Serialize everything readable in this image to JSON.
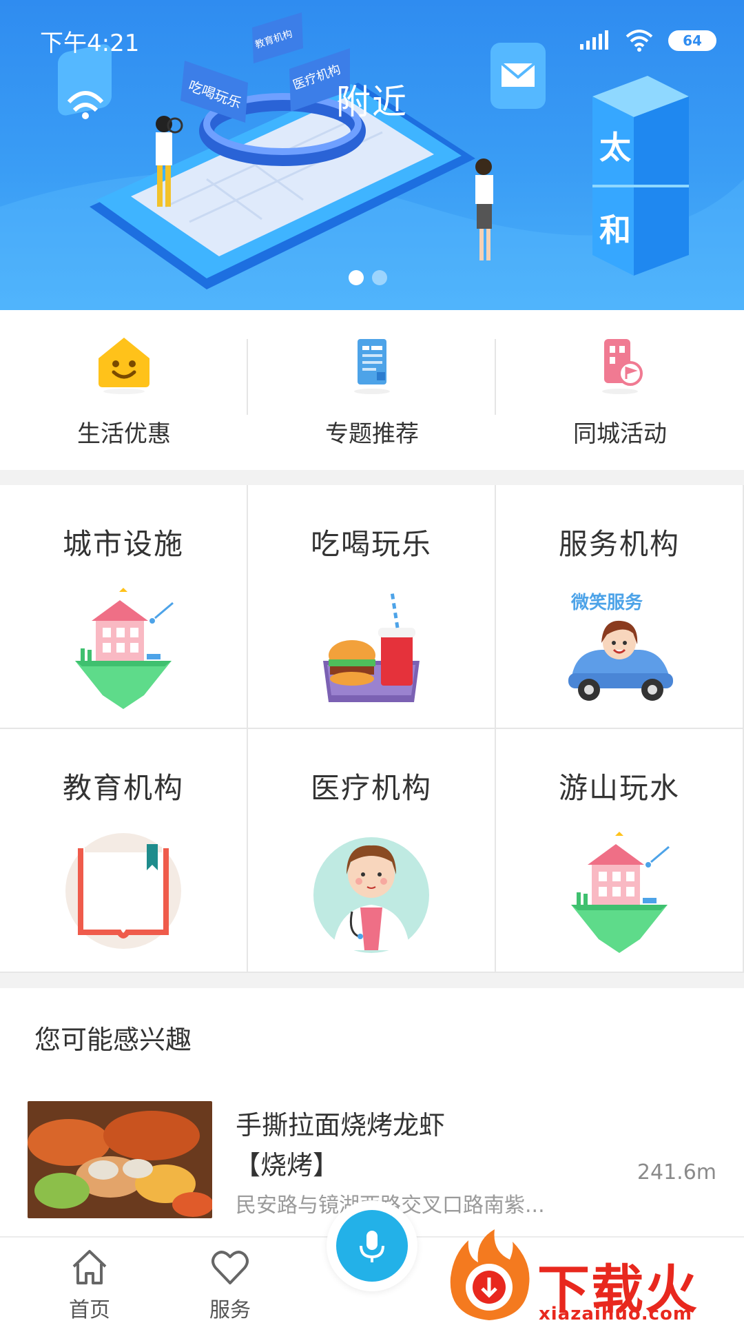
{
  "status_bar": {
    "time": "下午4:21",
    "battery": "64"
  },
  "banner": {
    "title": "附近",
    "tags": [
      "吃喝玩乐",
      "教育机构",
      "医疗机构"
    ],
    "side_text": [
      "太",
      "和"
    ],
    "slide_count": 2,
    "active_slide": 1
  },
  "quick_nav": [
    {
      "label": "生活优惠",
      "icon": "smiley-house-icon"
    },
    {
      "label": "专题推荐",
      "icon": "document-icon"
    },
    {
      "label": "同城活动",
      "icon": "building-flag-icon"
    }
  ],
  "categories": [
    {
      "title": "城市设施",
      "art": "floating-house-illustration"
    },
    {
      "title": "吃喝玩乐",
      "art": "burger-drink-tray-illustration"
    },
    {
      "title": "服务机构",
      "art": "smile-service-car-illustration",
      "art_text": "微笑服务"
    },
    {
      "title": "教育机构",
      "art": "open-book-illustration"
    },
    {
      "title": "医疗机构",
      "art": "doctor-illustration"
    },
    {
      "title": "游山玩水",
      "art": "floating-house-illustration"
    }
  ],
  "interest": {
    "title": "您可能感兴趣",
    "items": [
      {
        "name": "手撕拉面烧烤龙虾",
        "tag": "【烧烤】",
        "address": "民安路与镜湖西路交叉口路南紫...",
        "distance": "241.6m"
      }
    ]
  },
  "tabbar": {
    "tabs": [
      {
        "label": "首页",
        "icon": "home-icon"
      },
      {
        "label": "服务",
        "icon": "heart-icon"
      }
    ],
    "mic_icon": "microphone-icon"
  },
  "watermark": {
    "text": "下载火",
    "sub": "xiazaihuo.com"
  },
  "colors": {
    "banner": "#2f8cf0",
    "mic": "#23b1e8",
    "watermark": "#e8281e"
  }
}
